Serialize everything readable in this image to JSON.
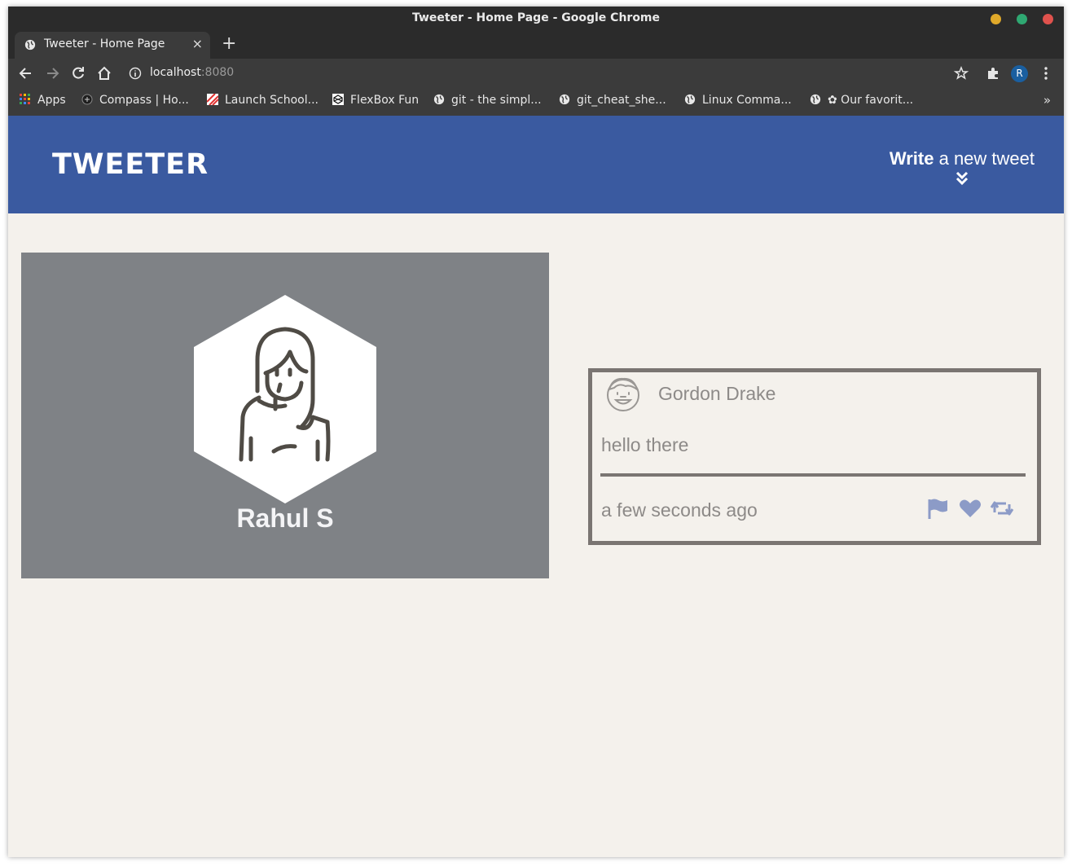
{
  "browser": {
    "window_title": "Tweeter - Home Page - Google Chrome",
    "tab_title": "Tweeter - Home Page",
    "tab_close": "×",
    "new_tab": "+",
    "url_host": "localhost",
    "url_port": ":8080",
    "profile_initial": "R",
    "bookmarks": [
      {
        "label": "Apps",
        "icon": "apps-grid-icon"
      },
      {
        "label": "Compass | Ho...",
        "icon": "compass-icon"
      },
      {
        "label": "Launch School...",
        "icon": "launch-school-icon"
      },
      {
        "label": "FlexBox Fun",
        "icon": "codepen-icon"
      },
      {
        "label": "git - the simpl...",
        "icon": "globe-icon"
      },
      {
        "label": "git_cheat_she...",
        "icon": "globe-icon"
      },
      {
        "label": "Linux Comma...",
        "icon": "globe-icon"
      },
      {
        "label": "✿ Our favorit...",
        "icon": "globe-icon"
      }
    ],
    "bookmarks_more": "»",
    "window_buttons": {
      "minimize": "#e0a92a",
      "maximize": "#2fa872",
      "close": "#e0524d"
    }
  },
  "nav": {
    "logo": "TWEETER",
    "compose_bold": "Write",
    "compose_rest": " a new tweet",
    "color": "#3a5aa0"
  },
  "profile": {
    "name": "Rahul S",
    "background": "#7f8286"
  },
  "tweet": {
    "author": "Gordon Drake",
    "content": "hello there",
    "timestamp": "a few seconds ago",
    "actions": [
      "flag-icon",
      "heart-icon",
      "retweet-icon"
    ],
    "action_color": "#8c9bc7"
  }
}
